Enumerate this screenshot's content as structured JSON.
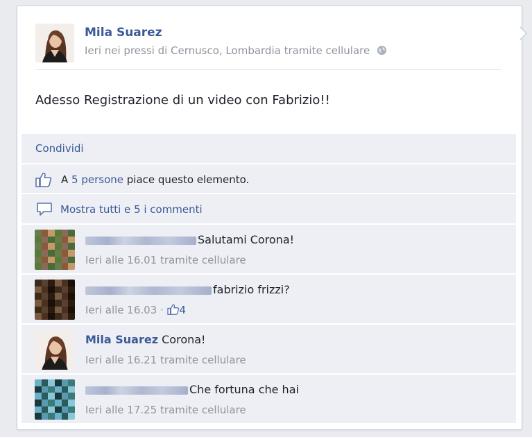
{
  "post": {
    "author": "Mila Suarez",
    "meta": "Ieri nei pressi di Cernusco, Lombardia tramite cellulare",
    "text": "Adesso Registrazione di un video con Fabrizio!!"
  },
  "actions": {
    "share": "Condividi"
  },
  "likes": {
    "prefix": "A ",
    "link": "5 persone",
    "suffix": " piace questo elemento."
  },
  "show_all": "Mostra tutti e 5 i commenti",
  "comments": [
    {
      "author": "",
      "text": "Salutami Corona!",
      "meta": "Ieri alle 16.01 tramite cellulare",
      "likes": "",
      "colors": [
        "#6b7a4a",
        "#8a5a3a",
        "#c49a6a",
        "#5a7a3a",
        "#8a6a5a",
        "#4a6a3a"
      ]
    },
    {
      "author": "",
      "text": "fabrizio frizzi?",
      "meta": "Ieri alle 16.03 · ",
      "likes": "4",
      "colors": [
        "#3a2a1a",
        "#5a4030",
        "#2a1a10",
        "#7a5a40",
        "#4a3020",
        "#1a1008"
      ]
    },
    {
      "author": "Mila Suarez",
      "text": "Corona!",
      "meta": "Ieri alle 16.21 tramite cellulare",
      "likes": ""
    },
    {
      "author": "",
      "text": "Che fortuna che hai",
      "meta": "Ieri alle 17.25 tramite cellulare",
      "likes": "",
      "colors": [
        "#6ab0c8",
        "#2a5a5a",
        "#8ac8d8",
        "#1a3a3a",
        "#5a9ab0",
        "#3a7a7a"
      ]
    }
  ],
  "icons": {
    "globe": "globe-icon",
    "like": "thumbs-up-icon",
    "comment": "comment-bubble-icon"
  },
  "colors": {
    "link": "#3b5998",
    "ufi_bg": "#edeff4",
    "meta": "#90949c"
  }
}
